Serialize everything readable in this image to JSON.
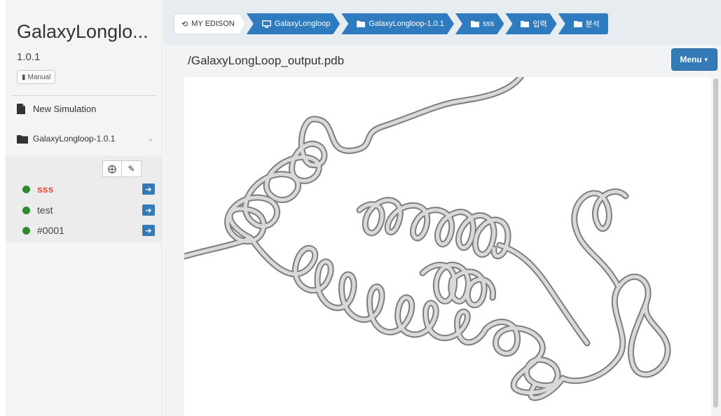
{
  "sidebar": {
    "app_title": "GalaxyLonglo...",
    "version": "1.0.1",
    "manual_label": "Manual",
    "new_simulation_label": "New Simulation",
    "folder_label": "GalaxyLongloop-1.0.1",
    "jobs": [
      {
        "name": "sss",
        "active": true
      },
      {
        "name": "test",
        "active": false
      },
      {
        "name": "#0001",
        "active": false
      }
    ]
  },
  "breadcrumb": {
    "home": "MY EDISON",
    "items": [
      "GalaxyLongloop",
      "GalaxyLongloop-1.0.1",
      "sss",
      "입력",
      "분석"
    ]
  },
  "content": {
    "file_title": "/GalaxyLongLoop_output.pdb",
    "menu_label": "Menu"
  },
  "colors": {
    "accent": "#337ab7",
    "status_dot": "#2d8a2d",
    "active_job": "#e74c3c"
  }
}
